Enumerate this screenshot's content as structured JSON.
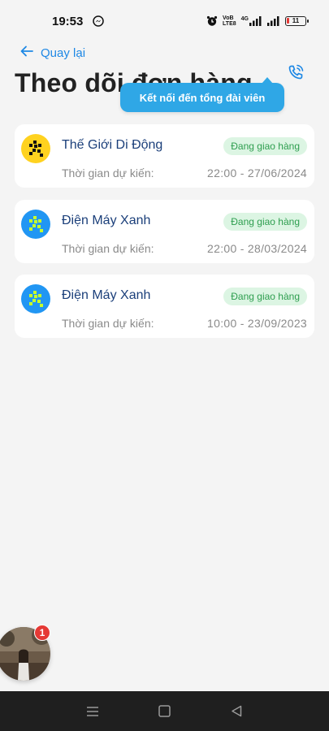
{
  "status_bar": {
    "time": "19:53",
    "network_label_top": "VoB",
    "network_label_bottom": "LTE8",
    "network_type": "4G",
    "battery": "11"
  },
  "header": {
    "back_label": "Quay lại",
    "title": "Theo dõi đơn hàng",
    "tooltip": "Kết nối đến tổng đài viên"
  },
  "orders": [
    {
      "store": "Thế Giới Di Động",
      "status": "Đang giao hàng",
      "eta_label": "Thời gian dự kiến:",
      "eta": "22:00 - 27/06/2024",
      "logo_color": "#ffd21f"
    },
    {
      "store": "Điện Máy Xanh",
      "status": "Đang giao hàng",
      "eta_label": "Thời gian dự kiến:",
      "eta": "22:00 - 28/03/2024",
      "logo_color": "#2196f3"
    },
    {
      "store": "Điện Máy Xanh",
      "status": "Đang giao hàng",
      "eta_label": "Thời gian dự kiến:",
      "eta": "10:00 - 23/09/2023",
      "logo_color": "#2196f3"
    }
  ],
  "floating_chat": {
    "badge": "1"
  },
  "colors": {
    "accent": "#1e88e5",
    "tooltip": "#2fa7e6",
    "status_green": "#2e9e4f",
    "status_bg": "#dcf5e3",
    "store_name": "#1b3f7a"
  },
  "icons": {
    "back": "arrow-left-icon",
    "call": "phone-call-icon",
    "nav_menu": "menu-icon",
    "nav_home": "square-icon",
    "nav_back": "triangle-back-icon"
  }
}
